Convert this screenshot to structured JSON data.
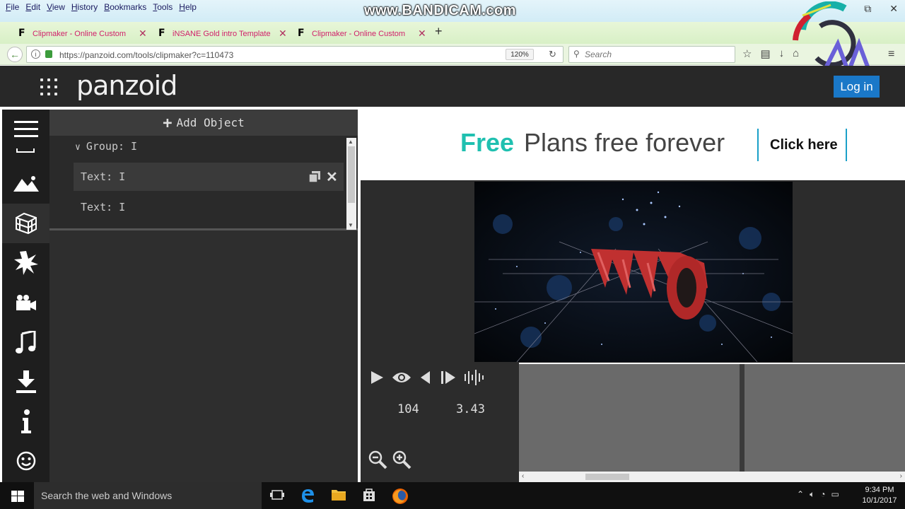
{
  "menu": [
    "File",
    "Edit",
    "View",
    "History",
    "Bookmarks",
    "Tools",
    "Help"
  ],
  "watermark": "www.BANDICAM.com",
  "tabs": [
    {
      "label": "Clipmaker - Online Custom"
    },
    {
      "label": "iNSANE Gold intro Template"
    },
    {
      "label": "Clipmaker - Online Custom"
    }
  ],
  "nav": {
    "url": "https://panzoid.com/tools/clipmaker?c=110473",
    "zoom": "120%",
    "search_placeholder": "Search"
  },
  "site": {
    "brand": "panzoid",
    "login": "Log in"
  },
  "panel": {
    "add_object": "Add Object",
    "items": [
      {
        "label": "Group: I"
      },
      {
        "label": "Text: I"
      },
      {
        "label": "Text: I"
      }
    ]
  },
  "ad": {
    "free": "Free",
    "plans": "Plans free forever",
    "cta": "Click here"
  },
  "controls": {
    "frame": "104",
    "time": "3.43"
  },
  "taskbar": {
    "search": "Search the web and Windows",
    "time": "9:34 PM",
    "date": "10/1/2017"
  },
  "colors": {
    "site_header": "#282828",
    "login_button": "#1a78c8",
    "ad_free": "#20c0b0",
    "tab_text": "#d0206a"
  }
}
